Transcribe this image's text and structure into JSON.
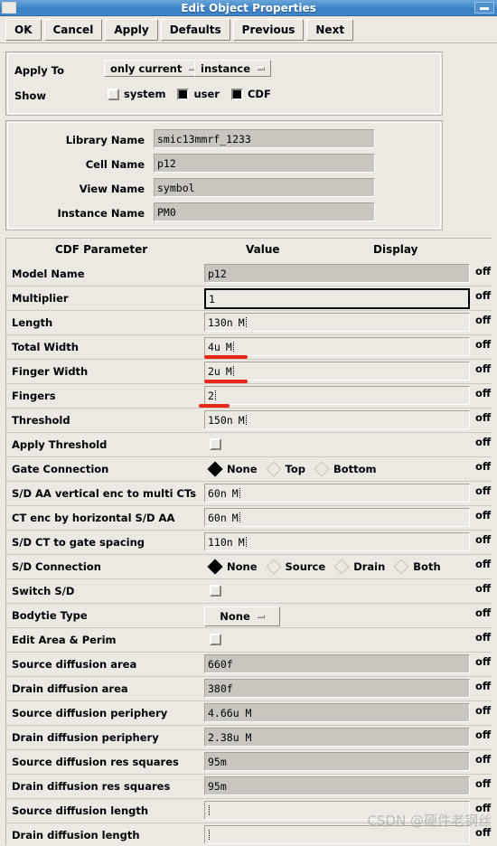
{
  "window": {
    "title": "Edit Object Properties",
    "minimize_icon": "minimize-icon",
    "system_menu_icon": "system-menu-icon"
  },
  "toolbar": {
    "buttons": [
      {
        "label": "OK",
        "name": "ok-button"
      },
      {
        "label": "Cancel",
        "name": "cancel-button"
      },
      {
        "label": "Apply",
        "name": "apply-button"
      },
      {
        "label": "Defaults",
        "name": "defaults-button"
      },
      {
        "label": "Previous",
        "name": "previous-button"
      },
      {
        "label": "Next",
        "name": "next-button"
      }
    ]
  },
  "apply_panel": {
    "apply_to_label": "Apply To",
    "apply_to_scope": "only current",
    "apply_to_target": "instance",
    "show_label": "Show",
    "show_options": [
      {
        "label": "system",
        "checked": false
      },
      {
        "label": "user",
        "checked": true
      },
      {
        "label": "CDF",
        "checked": true
      }
    ]
  },
  "identity_panel": {
    "fields": [
      {
        "label": "Library Name",
        "value": "smic13mmrf_1233",
        "readonly": true
      },
      {
        "label": "Cell Name",
        "value": "p12",
        "readonly": true
      },
      {
        "label": "View Name",
        "value": "symbol",
        "readonly": true
      },
      {
        "label": "Instance Name",
        "value": "PM0",
        "readonly": true
      }
    ]
  },
  "cdf_table": {
    "headers": {
      "parameter": "CDF Parameter",
      "value": "Value",
      "display": "Display"
    },
    "display_value": "off",
    "rows": [
      {
        "name": "Model Name",
        "kind": "text",
        "value": "p12",
        "readonly": true,
        "display": "off"
      },
      {
        "name": "Multiplier",
        "kind": "text",
        "value": "1",
        "selected": true,
        "display": "off"
      },
      {
        "name": "Length",
        "kind": "text",
        "value": "130n",
        "unit": "M",
        "cursor": true,
        "display": "off"
      },
      {
        "name": "Total Width",
        "kind": "text",
        "value": "4u",
        "unit": "M",
        "cursor": true,
        "display": "off",
        "annotated": true
      },
      {
        "name": "Finger Width",
        "kind": "text",
        "value": "2u",
        "unit": "M",
        "cursor": true,
        "display": "off",
        "annotated": true
      },
      {
        "name": "Fingers",
        "kind": "text",
        "value": "2",
        "cursor": true,
        "display": "off",
        "annotated": true
      },
      {
        "name": "Threshold",
        "kind": "text",
        "value": "150n",
        "unit": "M",
        "cursor": true,
        "display": "off"
      },
      {
        "name": "Apply Threshold",
        "kind": "check",
        "checked": false,
        "display": "off"
      },
      {
        "name": "Gate Connection",
        "kind": "radio",
        "options": [
          "None",
          "Top",
          "Bottom"
        ],
        "selected_index": 0,
        "display": "off"
      },
      {
        "name": "S/D AA vertical enc to multi CTs",
        "kind": "text",
        "value": "60n",
        "unit": "M",
        "cursor": true,
        "display": "off"
      },
      {
        "name": "CT enc by horizontal S/D AA",
        "kind": "text",
        "value": "60n",
        "unit": "M",
        "cursor": true,
        "display": "off"
      },
      {
        "name": "S/D CT to gate spacing",
        "kind": "text",
        "value": "110n",
        "unit": "M",
        "cursor": true,
        "display": "off"
      },
      {
        "name": "S/D Connection",
        "kind": "radio",
        "options": [
          "None",
          "Source",
          "Drain",
          "Both"
        ],
        "selected_index": 0,
        "display": "off"
      },
      {
        "name": "Switch S/D",
        "kind": "check",
        "checked": false,
        "display": "off"
      },
      {
        "name": "Bodytie Type",
        "kind": "menu",
        "value": "None",
        "display": "off"
      },
      {
        "name": "Edit Area & Perim",
        "kind": "check",
        "checked": false,
        "display": "off"
      },
      {
        "name": "Source diffusion area",
        "kind": "text",
        "value": "660f",
        "readonly": true,
        "display": "off"
      },
      {
        "name": "Drain diffusion area",
        "kind": "text",
        "value": "380f",
        "readonly": true,
        "display": "off"
      },
      {
        "name": "Source diffusion periphery",
        "kind": "text",
        "value": "4.66u M",
        "readonly": true,
        "display": "off"
      },
      {
        "name": "Drain diffusion periphery",
        "kind": "text",
        "value": "2.38u M",
        "readonly": true,
        "display": "off"
      },
      {
        "name": "Source diffusion res squares",
        "kind": "text",
        "value": "95m",
        "readonly": true,
        "display": "off"
      },
      {
        "name": "Drain diffusion res squares",
        "kind": "text",
        "value": "95m",
        "readonly": true,
        "display": "off"
      },
      {
        "name": "Source diffusion length",
        "kind": "text",
        "value": "",
        "cursor": true,
        "display": "off"
      },
      {
        "name": "Drain diffusion length",
        "kind": "text",
        "value": "",
        "cursor": true,
        "display": "off"
      }
    ]
  },
  "watermark": {
    "text": "CSDN @硬件老钢丝"
  },
  "colors": {
    "window_face": "#ece9e2",
    "titlebar": "#4287c8",
    "readonly_field": "#c9c6bf",
    "annotation_red": "#e8261a"
  }
}
